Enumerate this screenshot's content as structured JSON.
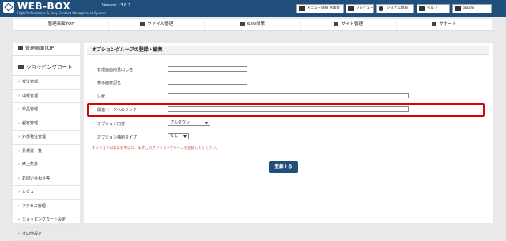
{
  "header": {
    "logo": "WEB-BOX",
    "tagline": "High Performance & Easy Content Management System",
    "version": "Version : 3.6.2",
    "buttons": {
      "menu_admin": "メニュー詳細 管理者",
      "preview": "プレビュー",
      "system_info": "システム情報",
      "help": "ヘルプ",
      "user": "graphi"
    }
  },
  "nav": {
    "items": [
      "管理画面TOP",
      "ファイル管理",
      "SEO対策",
      "サイト管理",
      "サポート"
    ]
  },
  "sidebar": {
    "top_label": "管理画面TOP",
    "category": "ショッピングカート",
    "items": [
      "受注管理",
      "出荷管理",
      "商品管理",
      "顧客管理",
      "外部発注管理",
      "見積書一覧",
      "売上集計",
      "お問い合わせ等",
      "レビュー",
      "アクセス管理",
      "ショッピングカート設定",
      "その他設定"
    ]
  },
  "form": {
    "title": "オプショングループの登録・編集",
    "fields": [
      {
        "label": "管理画面内見出し名"
      },
      {
        "label": "表示面表記名"
      },
      {
        "label": "注釈"
      },
      {
        "label": "関連ページへのリンク"
      }
    ],
    "option_content_label": "オプション内容",
    "option_content_value": "プルダウン",
    "option_aux_label": "オプション補助タイプ",
    "option_aux_value": "なし",
    "note": "オプション内容はお申込に、まずこのオプショングループを登録してください。",
    "submit": "登録する"
  }
}
